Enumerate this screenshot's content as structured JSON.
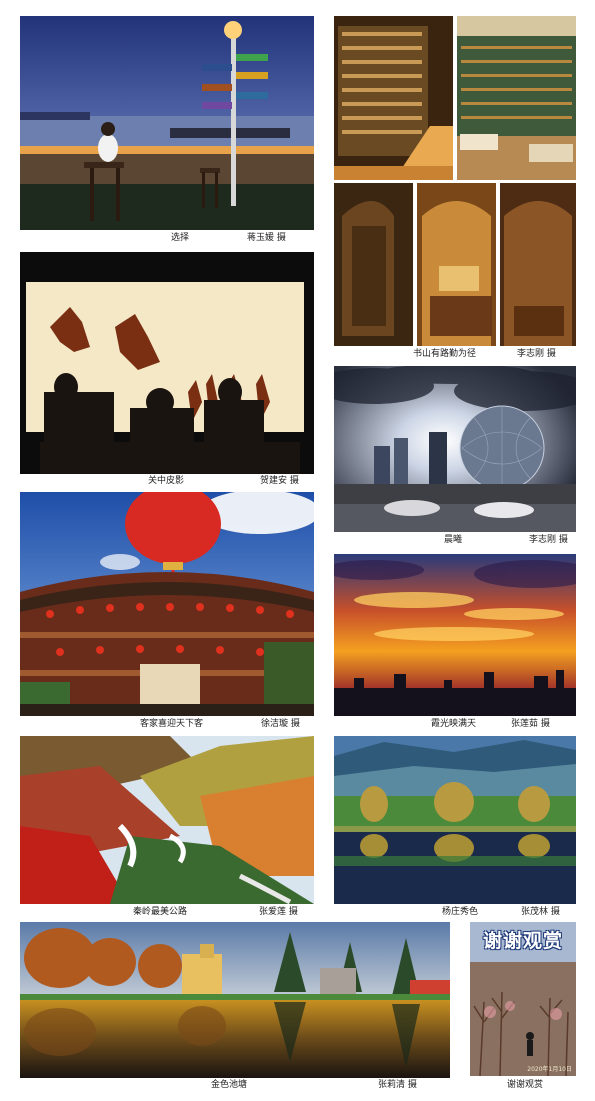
{
  "photos": [
    {
      "id": "p1",
      "title": "选择",
      "author": "蒋玉媛",
      "credit_suffix": "摄"
    },
    {
      "id": "p2",
      "title": "书山有路勤为径",
      "author": "李志刚",
      "credit_suffix": "摄"
    },
    {
      "id": "p3",
      "title": "关中皮影",
      "author": "贺建安",
      "credit_suffix": "摄"
    },
    {
      "id": "p4",
      "title": "晨曦",
      "author": "李志刚",
      "credit_suffix": "摄"
    },
    {
      "id": "p5",
      "title": "客家喜迎天下客",
      "author": "徐洁璇",
      "credit_suffix": "摄"
    },
    {
      "id": "p6",
      "title": "霞光映满天",
      "author": "张莲茹",
      "credit_suffix": "摄"
    },
    {
      "id": "p7",
      "title": "秦岭最美公路",
      "author": "张爱莲",
      "credit_suffix": "摄"
    },
    {
      "id": "p8",
      "title": "杨庄秀色",
      "author": "张茂林",
      "credit_suffix": "摄"
    },
    {
      "id": "p9",
      "title": "金色池塘",
      "author": "张莉清",
      "credit_suffix": "摄"
    }
  ],
  "thanks": {
    "banner": "谢谢观赏",
    "caption": "谢谢观赏",
    "stamp": "2020年1月10日"
  }
}
